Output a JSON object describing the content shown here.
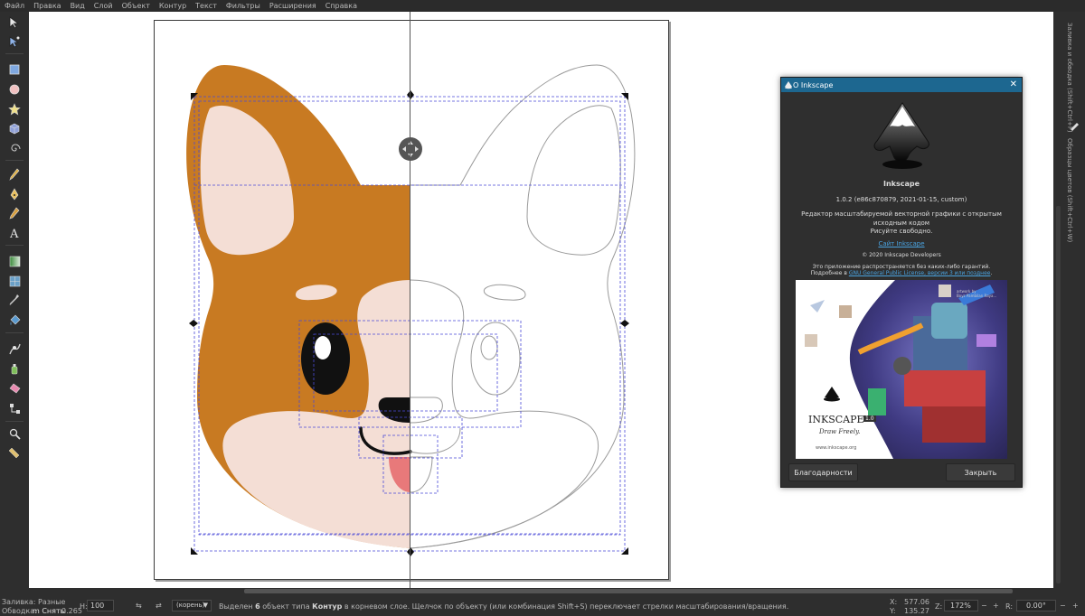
{
  "menu": [
    "Файл",
    "Правка",
    "Вид",
    "Слой",
    "Объект",
    "Контур",
    "Текст",
    "Фильтры",
    "Расширения",
    "Справка"
  ],
  "tools": [
    "selector-tool",
    "node-tool",
    "rectangle-tool",
    "ellipse-tool",
    "star-tool",
    "box-3d-tool",
    "spiral-tool",
    "pencil-tool",
    "pen-tool",
    "calligraphy-tool",
    "text-tool",
    "gradient-tool",
    "mesh-tool",
    "dropper-tool",
    "paint-bucket-tool",
    "tweak-tool",
    "spray-tool",
    "eraser-tool",
    "connector-tool",
    "zoom-tool",
    "measure-tool"
  ],
  "dock": {
    "tab_swatches": "Образцы цветов (Shift+Ctrl+W)",
    "tab_fill_stroke": "Заливка и обводка (Shift+Ctrl+F)"
  },
  "colors": {
    "fur": "#c87a22",
    "cream": "#f4ded5",
    "nose": "#111111",
    "tongue": "#e8797a",
    "selection": "#4a4ad8",
    "titlebar": "#1d6790",
    "link": "#4aa3e0"
  },
  "about": {
    "title": "О Inkscape",
    "close_icon": "close-icon",
    "app_name": "Inkscape",
    "version": "1.0.2 (e86c870879, 2021-01-15, custom)",
    "description": "Редактор масштабируемой векторной графики с открытым исходным кодом",
    "tagline": "Рисуйте свободно.",
    "website_link": "Сайт Inkscape",
    "copyright": "© 2020 Inkscape Developers",
    "warranty": "Это приложение распространяется без каких-либо гарантий.",
    "license_prefix": "Подробнее в",
    "license_link": "GNU General Public License, версии 3 или позднее",
    "license_suffix": ".",
    "splash_brand": "INKSCAPE",
    "splash_version": "1.0",
    "splash_slogan": "Draw Freely.",
    "splash_url": "www.inkscape.org",
    "splash_credit": "artwork by\nBoyz Pambilan Raya...",
    "credits_button": "Благодарности",
    "close_button": "Закрыть"
  },
  "status": {
    "fill_label": "Заливка:",
    "fill_value": "Разные",
    "stroke_label": "Обводка:",
    "stroke_value": "m Сняты",
    "stroke_width": "0.265",
    "h_label": "H:",
    "h_value": "100",
    "layer": "(корень)",
    "message_pre": "Выделен ",
    "message_count": "6",
    "message_mid": " объект типа ",
    "message_type": "Контур",
    "message_post": " в корневом слое. Щелчок по объекту (или комбинация Shift+S) переключает стрелки масштабирования/вращения.",
    "x_label": "X:",
    "x_value": "577.06",
    "y_label": "Y:",
    "y_value": "135.27",
    "z_label": "Z:",
    "zoom": "172%",
    "r_label": "R:",
    "rotation": "0.00°"
  }
}
